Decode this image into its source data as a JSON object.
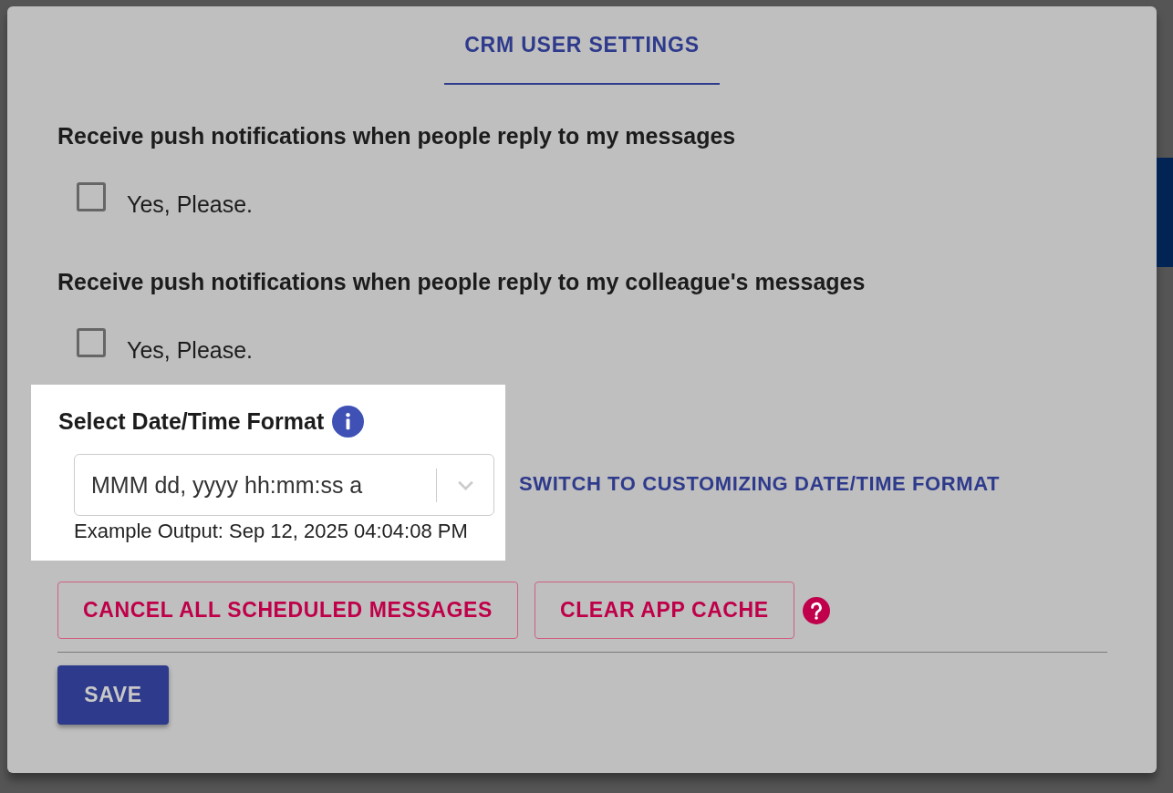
{
  "tabs": [
    {
      "label": "CRM USER SETTINGS",
      "selected": true
    }
  ],
  "settings": [
    {
      "heading": "Receive push notifications when people reply to my messages",
      "option": {
        "label": "Yes, Please.",
        "checked": false
      }
    },
    {
      "heading": "Receive push notifications when people reply to my colleague's messages",
      "option": {
        "label": "Yes, Please.",
        "checked": false
      }
    }
  ],
  "date_time_format": {
    "highlighted": true,
    "heading": "Select Date/Time Format",
    "select": {
      "value": "MMM dd, yyyy hh:mm:ss a"
    },
    "example": "Example Output: Sep 12, 2025 04:04:08 PM",
    "switch_link": "SWITCH TO CUSTOMIZING DATE/TIME FORMAT"
  },
  "actions": [
    {
      "label": "CANCEL ALL SCHEDULED MESSAGES",
      "kind": "button"
    },
    {
      "label": "CLEAR APP CACHE",
      "kind": "button"
    },
    {
      "kind": "help"
    }
  ],
  "save_button": {
    "label": "SAVE"
  }
}
